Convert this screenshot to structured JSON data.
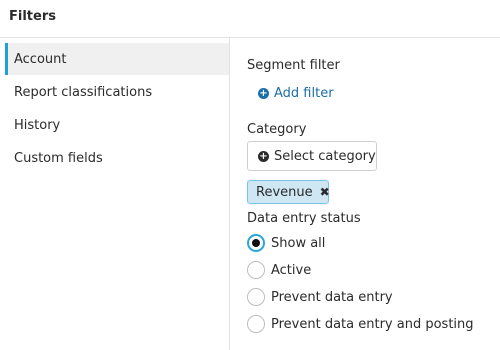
{
  "header": {
    "title": "Filters"
  },
  "sidebar": {
    "items": [
      {
        "label": "Account",
        "active": true
      },
      {
        "label": "Report classifications",
        "active": false
      },
      {
        "label": "History",
        "active": false
      },
      {
        "label": "Custom fields",
        "active": false
      }
    ]
  },
  "panel": {
    "segment_filter": {
      "label": "Segment filter",
      "add_label": "Add filter",
      "icon": "plus-circle-icon"
    },
    "category": {
      "label": "Category",
      "select_label": "Select category",
      "icon": "plus-circle-icon",
      "selected_tags": [
        {
          "label": "Revenue",
          "remove_icon": "close-icon"
        }
      ]
    },
    "data_entry_status": {
      "label": "Data entry status",
      "options": [
        {
          "label": "Show all",
          "checked": true
        },
        {
          "label": "Active",
          "checked": false
        },
        {
          "label": "Prevent data entry",
          "checked": false
        },
        {
          "label": "Prevent data entry and posting",
          "checked": false
        }
      ]
    }
  },
  "colors": {
    "accent": "#1aa3d4",
    "link": "#1b6fa8",
    "tag_bg": "#cfe7f4",
    "tag_border": "#7ec2e4"
  }
}
